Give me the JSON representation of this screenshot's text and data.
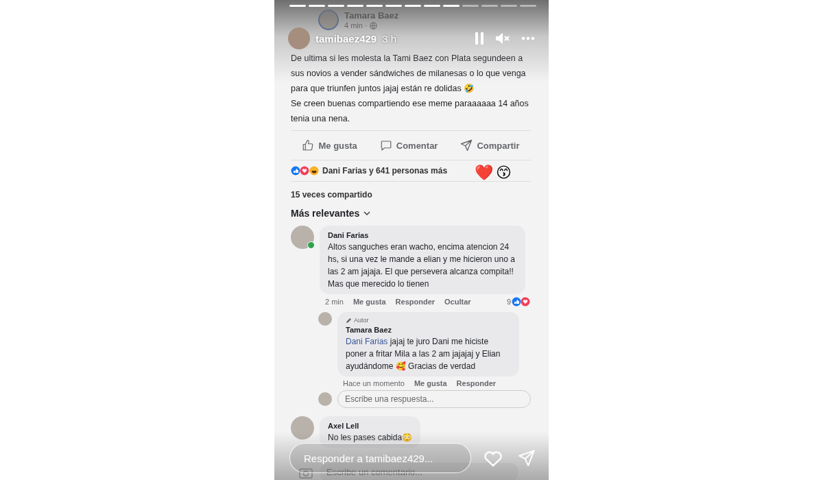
{
  "story": {
    "username": "tamibaez429",
    "time": "3 h",
    "paused": true,
    "muted": true,
    "segments": [
      {
        "seen": true
      },
      {
        "seen": true
      },
      {
        "seen": true
      },
      {
        "seen": true
      },
      {
        "seen": true
      },
      {
        "seen": true
      },
      {
        "seen": true
      },
      {
        "seen": true
      },
      {
        "seen": true
      },
      {
        "seen": false
      },
      {
        "seen": false
      },
      {
        "seen": false
      },
      {
        "seen": false
      }
    ],
    "reply_placeholder": "Responder a tamibaez429...",
    "stickers": [
      "❤️",
      "😙"
    ]
  },
  "post": {
    "author": "Tamara Baez",
    "time": "4 min ·",
    "text": "De ultima si les molesta la Tami Baez con Plata segundeen a sus novios a vender sándwiches de milanesas o lo que venga para que triunfen juntos jajaj están re dolidas 🤣\nSe creen buenas compartiendo ese meme paraaaaaa 14 años tenia una nena.",
    "actions": [
      "Me gusta",
      "Comentar",
      "Compartir"
    ],
    "reactions": "Dani Farias y 641 personas más",
    "shares": "15 veces compartido",
    "sort": "Más relevantes"
  },
  "comments": [
    {
      "author": "Dani Farias",
      "online": true,
      "text": "Altos sanguches eran wacho, encima atencion 24 hs, si una vez le mande a elian y me hicieron uno a las 2 am jajaja. El que persevera alcanza compita!! Mas que merecido lo tienen",
      "meta": [
        "2 min",
        "Me gusta",
        "Responder",
        "Ocultar"
      ],
      "reaction_count": "9",
      "replies": [
        {
          "badge": "Autor",
          "author": "Tamara Baez",
          "mention": "Dani Farias",
          "text": "jajaj te juro Dani me hiciste poner a fritar Mila a las 2 am jajajaj y Elian ayudándome 🥰 Gracias de verdad",
          "meta": [
            "Hace un momento",
            "Me gusta",
            "Responder"
          ]
        }
      ],
      "reply_placeholder": "Escribe una respuesta..."
    },
    {
      "author": "Axel Lell",
      "online": false,
      "text": "No les  pases cabida😳"
    }
  ],
  "comment_placeholder": "Escribe un comentario..."
}
